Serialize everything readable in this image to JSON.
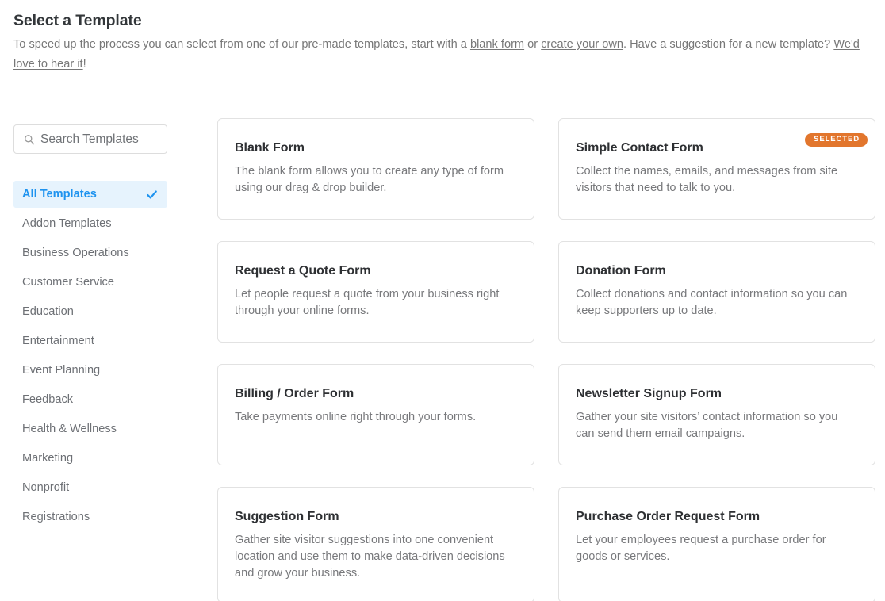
{
  "header": {
    "title": "Select a Template",
    "desc_part1": "To speed up the process you can select from one of our pre-made templates, start with a ",
    "link_blank_form": "blank form",
    "desc_part2": " or ",
    "link_create_own": "create your own",
    "desc_part3": ". Have a suggestion for a new template? ",
    "link_suggestion": "We'd love to hear it",
    "desc_part4": "!"
  },
  "sidebar": {
    "search": {
      "placeholder": "Search Templates",
      "value": "",
      "icon": "search-icon"
    },
    "categories": [
      {
        "label": "All Templates",
        "active": true,
        "icon": "check-icon"
      },
      {
        "label": "Addon Templates",
        "active": false
      },
      {
        "label": "Business Operations",
        "active": false
      },
      {
        "label": "Customer Service",
        "active": false
      },
      {
        "label": "Education",
        "active": false
      },
      {
        "label": "Entertainment",
        "active": false
      },
      {
        "label": "Event Planning",
        "active": false
      },
      {
        "label": "Feedback",
        "active": false
      },
      {
        "label": "Health & Wellness",
        "active": false
      },
      {
        "label": "Marketing",
        "active": false
      },
      {
        "label": "Nonprofit",
        "active": false
      },
      {
        "label": "Registrations",
        "active": false
      }
    ]
  },
  "templates": [
    {
      "title": "Blank Form",
      "desc": "The blank form allows you to create any type of form using our drag & drop builder.",
      "selected": false
    },
    {
      "title": "Simple Contact Form",
      "desc": "Collect the names, emails, and messages from site visitors that need to talk to you.",
      "selected": true,
      "badge": "SELECTED"
    },
    {
      "title": "Request a Quote Form",
      "desc": "Let people request a quote from your business right through your online forms.",
      "selected": false
    },
    {
      "title": "Donation Form",
      "desc": "Collect donations and contact information so you can keep supporters up to date.",
      "selected": false
    },
    {
      "title": "Billing / Order Form",
      "desc": "Take payments online right through your forms.",
      "selected": false
    },
    {
      "title": "Newsletter Signup Form",
      "desc": "Gather your site visitors’ contact information so you can send them email campaigns.",
      "selected": false
    },
    {
      "title": "Suggestion Form",
      "desc": "Gather site visitor suggestions into one convenient location and use them to make data-driven decisions and grow your business.",
      "selected": false,
      "tall": true
    },
    {
      "title": "Purchase Order Request Form",
      "desc": "Let your employees request a purchase order for goods or services.",
      "selected": false,
      "tall": true
    }
  ],
  "colors": {
    "accent_blue": "#1e93ef",
    "accent_blue_bg": "#e6f3fd",
    "badge_orange": "#e2762d",
    "text_dark": "#2e3033",
    "text_muted": "#777777",
    "border": "#e2e2e2"
  }
}
